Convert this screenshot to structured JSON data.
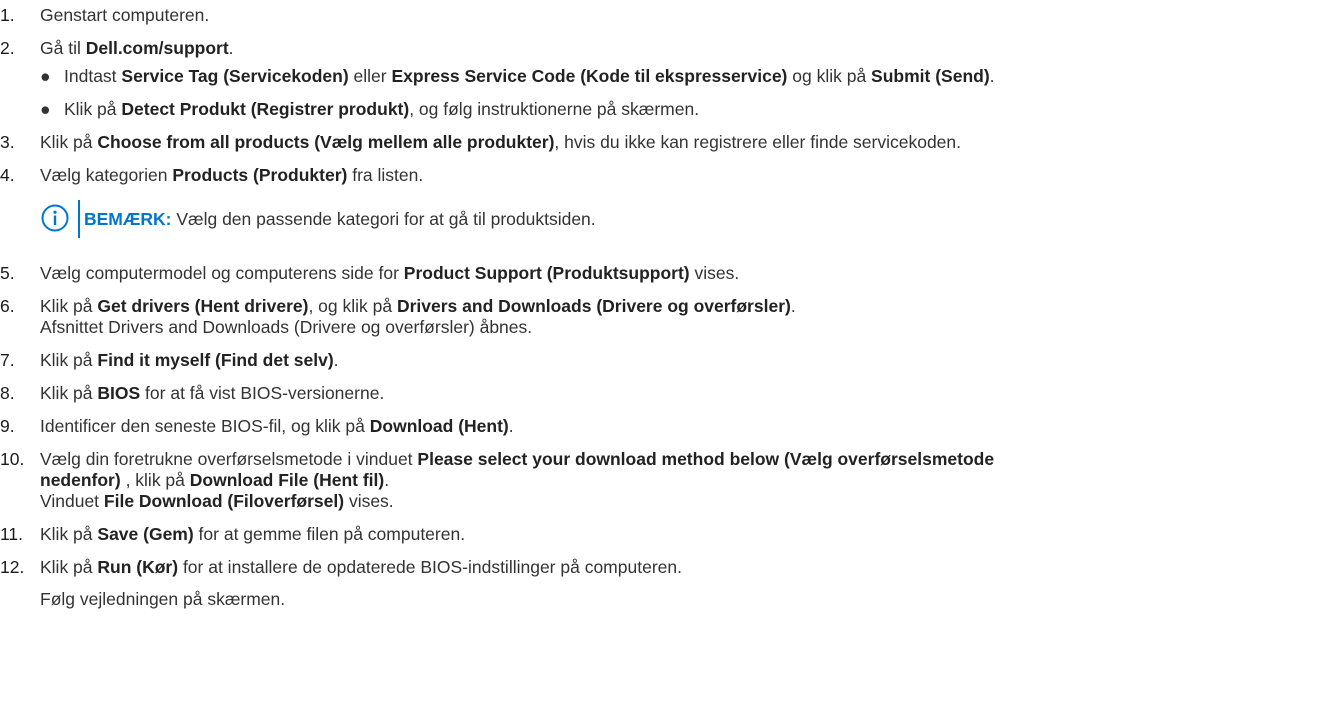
{
  "steps": [
    {
      "num": "1.",
      "parts": [
        {
          "t": "Genstart computeren.",
          "b": false
        }
      ]
    },
    {
      "num": "2.",
      "parts": [
        {
          "t": "Gå til ",
          "b": false
        },
        {
          "t": "Dell.com/support",
          "b": true
        },
        {
          "t": ".",
          "b": false
        }
      ],
      "bullets": [
        [
          {
            "t": "Indtast ",
            "b": false
          },
          {
            "t": "Service Tag (Servicekoden)",
            "b": true
          },
          {
            "t": " eller ",
            "b": false
          },
          {
            "t": "Express Service Code (Kode til ekspresservice)",
            "b": true
          },
          {
            "t": " og klik på ",
            "b": false
          },
          {
            "t": "Submit (Send)",
            "b": true
          },
          {
            "t": ".",
            "b": false
          }
        ],
        [
          {
            "t": "Klik på ",
            "b": false
          },
          {
            "t": "Detect Produkt (Registrer produkt)",
            "b": true
          },
          {
            "t": ", og følg instruktionerne på skærmen.",
            "b": false
          }
        ]
      ]
    },
    {
      "num": "3.",
      "parts": [
        {
          "t": "Klik på ",
          "b": false
        },
        {
          "t": "Choose from all products (Vælg mellem alle produkter)",
          "b": true
        },
        {
          "t": ", hvis du ikke kan registrere eller finde servicekoden.",
          "b": false
        }
      ]
    },
    {
      "num": "4.",
      "parts": [
        {
          "t": "Vælg kategorien ",
          "b": false
        },
        {
          "t": "Products (Produkter)",
          "b": true
        },
        {
          "t": " fra listen.",
          "b": false
        }
      ],
      "note": {
        "label": "BEMÆRK:",
        "text": " Vælg den passende kategori for at gå til produktsiden."
      }
    },
    {
      "num": "5.",
      "parts": [
        {
          "t": "Vælg computermodel og computerens side for ",
          "b": false
        },
        {
          "t": "Product Support (Produktsupport)",
          "b": true
        },
        {
          "t": " vises.",
          "b": false
        }
      ]
    },
    {
      "num": "6.",
      "parts": [
        {
          "t": "Klik på ",
          "b": false
        },
        {
          "t": "Get drivers (Hent drivere)",
          "b": true
        },
        {
          "t": ", og klik på ",
          "b": false
        },
        {
          "t": "Drivers and Downloads (Drivere og overførsler)",
          "b": true
        },
        {
          "t": ".",
          "b": false
        }
      ],
      "lines": [
        [
          {
            "t": "Afsnittet Drivers and Downloads (Drivere og overførsler) åbnes.",
            "b": false
          }
        ]
      ]
    },
    {
      "num": "7.",
      "parts": [
        {
          "t": "Klik på ",
          "b": false
        },
        {
          "t": "Find it myself (Find det selv)",
          "b": true
        },
        {
          "t": ".",
          "b": false
        }
      ]
    },
    {
      "num": "8.",
      "parts": [
        {
          "t": "Klik på ",
          "b": false
        },
        {
          "t": "BIOS",
          "b": true
        },
        {
          "t": " for at få vist BIOS-versionerne.",
          "b": false
        }
      ]
    },
    {
      "num": "9.",
      "parts": [
        {
          "t": "Identificer den seneste BIOS-fil, og klik på ",
          "b": false
        },
        {
          "t": "Download (Hent)",
          "b": true
        },
        {
          "t": ".",
          "b": false
        }
      ]
    },
    {
      "num": "10.",
      "parts": [
        {
          "t": "Vælg din foretrukne overførselsmetode i vinduet ",
          "b": false
        },
        {
          "t": "Please select your download method below (Vælg overførselsmetode",
          "b": true
        }
      ],
      "lines": [
        [
          {
            "t": "nedenfor)",
            "b": true
          },
          {
            "t": " , klik på ",
            "b": false
          },
          {
            "t": "Download File (Hent fil)",
            "b": true
          },
          {
            "t": ".",
            "b": false
          }
        ],
        [
          {
            "t": "Vinduet ",
            "b": false
          },
          {
            "t": "File Download (Filoverførsel)",
            "b": true
          },
          {
            "t": " vises.",
            "b": false
          }
        ]
      ]
    },
    {
      "num": "11.",
      "parts": [
        {
          "t": "Klik på ",
          "b": false
        },
        {
          "t": "Save (Gem)",
          "b": true
        },
        {
          "t": " for at gemme filen på computeren.",
          "b": false
        }
      ]
    },
    {
      "num": "12.",
      "parts": [
        {
          "t": "Klik på ",
          "b": false
        },
        {
          "t": "Run (Kør)",
          "b": true
        },
        {
          "t": " for at installere de opdaterede BIOS-indstillinger på computeren.",
          "b": false
        }
      ],
      "followup": "Følg vejledningen på skærmen."
    }
  ],
  "bullet_glyph": "●",
  "note_icon": "info-circle-icon",
  "accent_color": "#0076ce"
}
